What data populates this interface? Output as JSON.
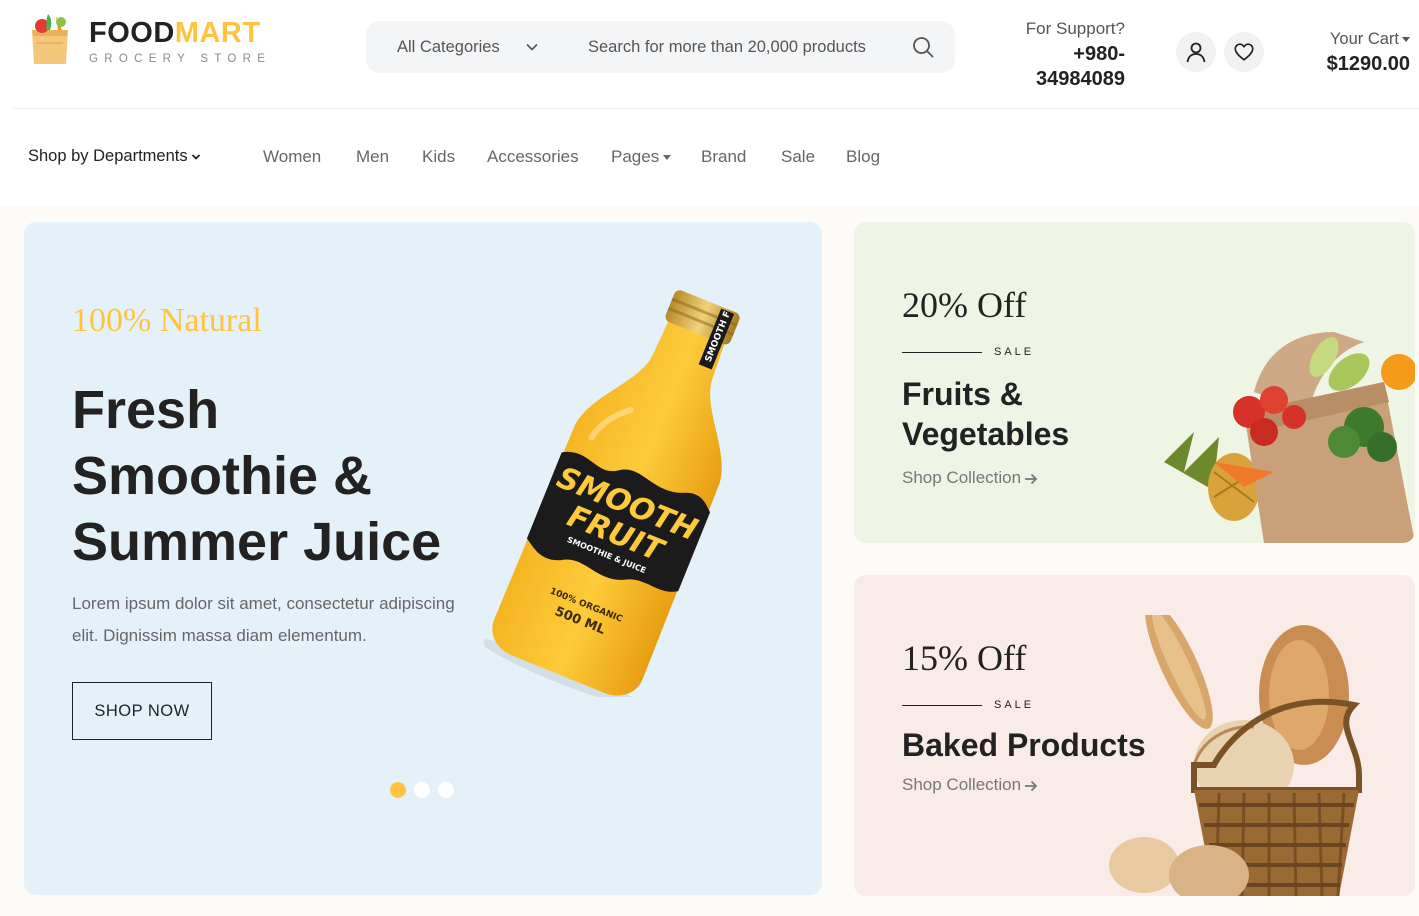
{
  "brand": {
    "name_part1": "FOOD",
    "name_part2": "MART",
    "tagline": "GROCERY STORE",
    "accent_color": "#FFC43F"
  },
  "search": {
    "category_label": "All Categories",
    "placeholder": "Search for more than 20,000 products"
  },
  "support": {
    "label": "For Support?",
    "phone": "+980-34984089"
  },
  "header_icons": {
    "user": "user-icon",
    "wishlist": "heart-icon"
  },
  "cart": {
    "label": "Your Cart",
    "total": "$1290.00"
  },
  "nav": {
    "departments_label": "Shop by Departments",
    "items": [
      {
        "label": "Women"
      },
      {
        "label": "Men"
      },
      {
        "label": "Kids"
      },
      {
        "label": "Accessories"
      },
      {
        "label": "Pages"
      },
      {
        "label": "Brand"
      },
      {
        "label": "Sale"
      },
      {
        "label": "Blog"
      }
    ]
  },
  "hero": {
    "eyebrow": "100% Natural",
    "title": "Fresh Smoothie & Summer Juice",
    "description": "Lorem ipsum dolor sit amet, consectetur adipiscing elit. Dignissim massa diam elementum.",
    "button_label": "SHOP NOW",
    "bottle_label_1": "SMOOTH",
    "bottle_label_2": "FRUIT",
    "bottle_sub": "SMOOTHIE & JUICE",
    "bottle_organic": "100% ORGANIC",
    "bottle_volume": "500 ML",
    "bottle_neck": "SMOOTH F",
    "slides": 3,
    "active_slide": 1,
    "background": "#e5f1f9"
  },
  "promos": [
    {
      "discount": "20% Off",
      "tag": "SALE",
      "title": "Fruits & Vegetables",
      "link": "Shop Collection",
      "background": "#eef5e4"
    },
    {
      "discount": "15% Off",
      "tag": "SALE",
      "title": "Baked Products",
      "link": "Shop Collection",
      "background": "#f9ebe7"
    }
  ]
}
